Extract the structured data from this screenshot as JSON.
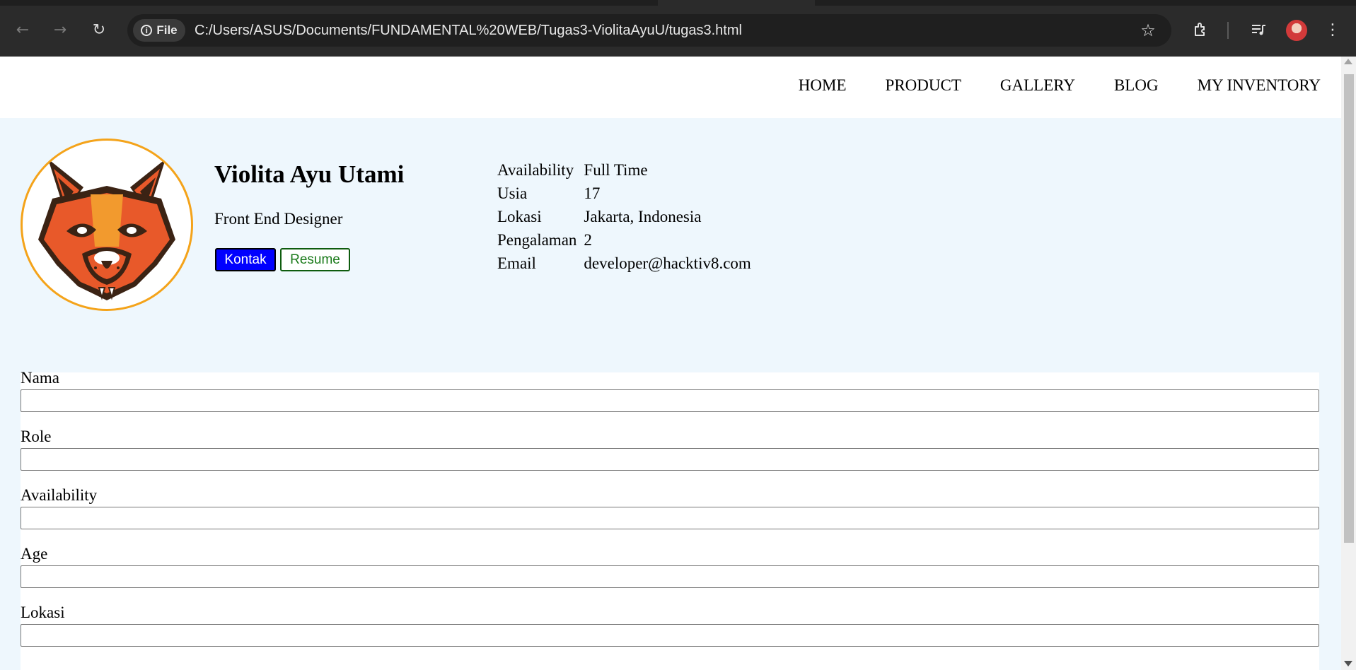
{
  "browser": {
    "url": "C:/Users/ASUS/Documents/FUNDAMENTAL%20WEB/Tugas3-ViolitaAyuU/tugas3.html",
    "scheme_chip": "File"
  },
  "nav": {
    "items": [
      "HOME",
      "PRODUCT",
      "GALLERY",
      "BLOG",
      "MY INVENTORY"
    ]
  },
  "profile": {
    "name": "Violita Ayu Utami",
    "role": "Front End Designer",
    "buttons": {
      "kontak": "Kontak",
      "resume": "Resume"
    },
    "details": [
      {
        "label": "Availability",
        "value": "Full Time"
      },
      {
        "label": "Usia",
        "value": "17"
      },
      {
        "label": "Lokasi",
        "value": "Jakarta, Indonesia"
      },
      {
        "label": "Pengalaman",
        "value": "2"
      },
      {
        "label": "Email",
        "value": "developer@hacktiv8.com"
      }
    ]
  },
  "form": {
    "fields": [
      {
        "label": "Nama",
        "value": ""
      },
      {
        "label": "Role",
        "value": ""
      },
      {
        "label": "Availability",
        "value": ""
      },
      {
        "label": "Age",
        "value": ""
      },
      {
        "label": "Lokasi",
        "value": ""
      }
    ]
  },
  "colors": {
    "hero_bg": "#eef7fd",
    "kontak_bg": "#0000ff",
    "resume_text": "#1a7a1a",
    "logo_ring": "#f4a31a",
    "fox_orange": "#e8592a",
    "fox_dark": "#3b2314"
  }
}
